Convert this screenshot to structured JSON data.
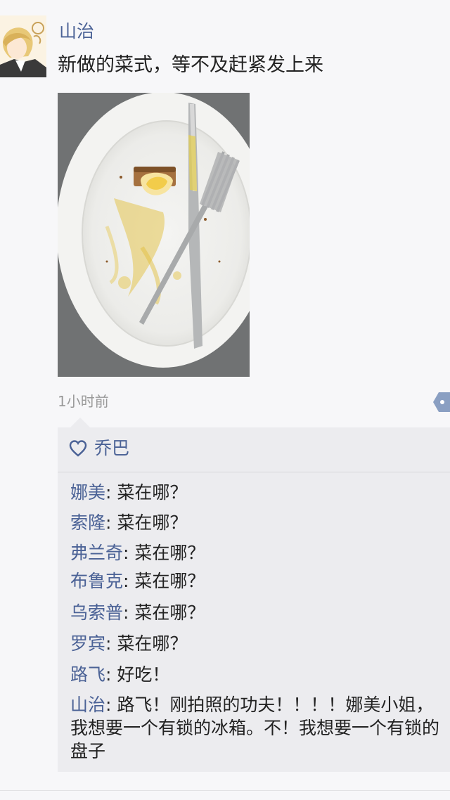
{
  "post": {
    "username": "山治",
    "text": "新做的菜式，等不及赶紧发上来",
    "timestamp": "1小时前"
  },
  "likes": {
    "names": "乔巴"
  },
  "comments": [
    {
      "author": "娜美",
      "text": ": 菜在哪？"
    },
    {
      "author": "索隆",
      "text": ": 菜在哪？"
    },
    {
      "author": "弗兰奇",
      "text": ": 菜在哪？"
    },
    {
      "author": "布鲁克",
      "text": ": 菜在哪？"
    },
    {
      "author": "乌索普",
      "text": ": 菜在哪？"
    },
    {
      "author": "罗宾",
      "text": ": 菜在哪？"
    },
    {
      "author": "路飞",
      "text": ": 好吃！"
    },
    {
      "author": "山治",
      "text": ": 路飞！刚拍照的功夫！！！！娜美小姐，我想要一个有锁的冰箱。不！我想要一个有锁的盘子"
    }
  ],
  "colors": {
    "name_blue": "#4b6296",
    "comment_bg": "#ececef"
  },
  "icons": {
    "like": "heart-icon",
    "more": "more-dots-icon"
  }
}
